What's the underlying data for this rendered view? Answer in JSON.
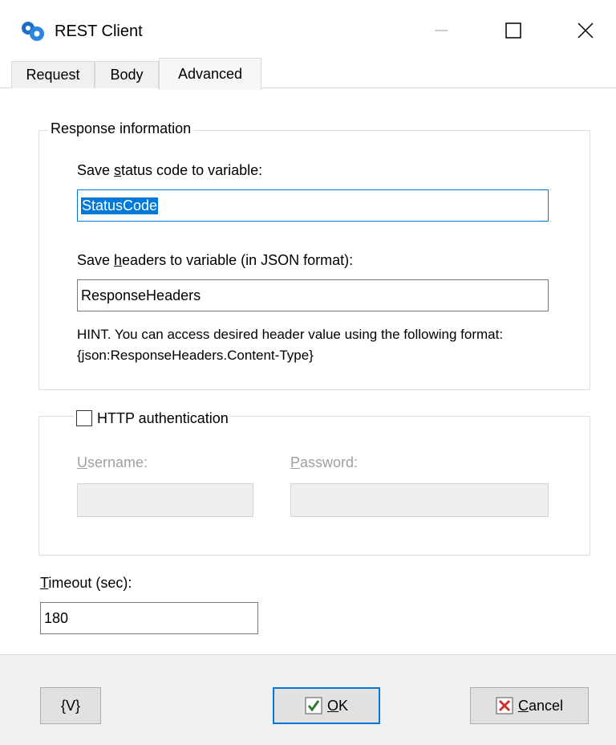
{
  "window": {
    "title": "REST Client",
    "icon": "rest-client-app-icon",
    "controls": [
      "minimize-icon",
      "maximize-icon",
      "close-icon"
    ]
  },
  "tabs": [
    {
      "label": "Request",
      "active": false
    },
    {
      "label": "Body",
      "active": false
    },
    {
      "label": "Advanced",
      "active": true
    }
  ],
  "response_info": {
    "legend": "Response information",
    "status_label_pre": "Save ",
    "status_label_accel": "s",
    "status_label_post": "tatus code to variable:",
    "status_value": "StatusCode",
    "headers_label_pre": "Save ",
    "headers_label_accel": "h",
    "headers_label_post": "eaders to variable (in JSON format):",
    "headers_value": "ResponseHeaders",
    "hint_line1": "HINT. You can access desired header value using the following format:",
    "hint_line2": "{json:ResponseHeaders.Content-Type}"
  },
  "http_auth": {
    "checkbox_label": "HTTP authentication",
    "checked": false,
    "username_accel": "U",
    "username_rest": "sername:",
    "username_value": "",
    "password_accel": "P",
    "password_rest": "assword:",
    "password_value": ""
  },
  "timeout": {
    "label_accel": "T",
    "label_rest": "imeout (sec):",
    "value": "180"
  },
  "footer": {
    "variables_button": "{V}",
    "ok_accel": "O",
    "ok_rest": "K",
    "cancel_accel": "C",
    "cancel_rest": "ancel"
  },
  "colors": {
    "accent": "#0078d7",
    "ok_check": "#2e7d32",
    "cancel_x": "#d32f2f"
  }
}
